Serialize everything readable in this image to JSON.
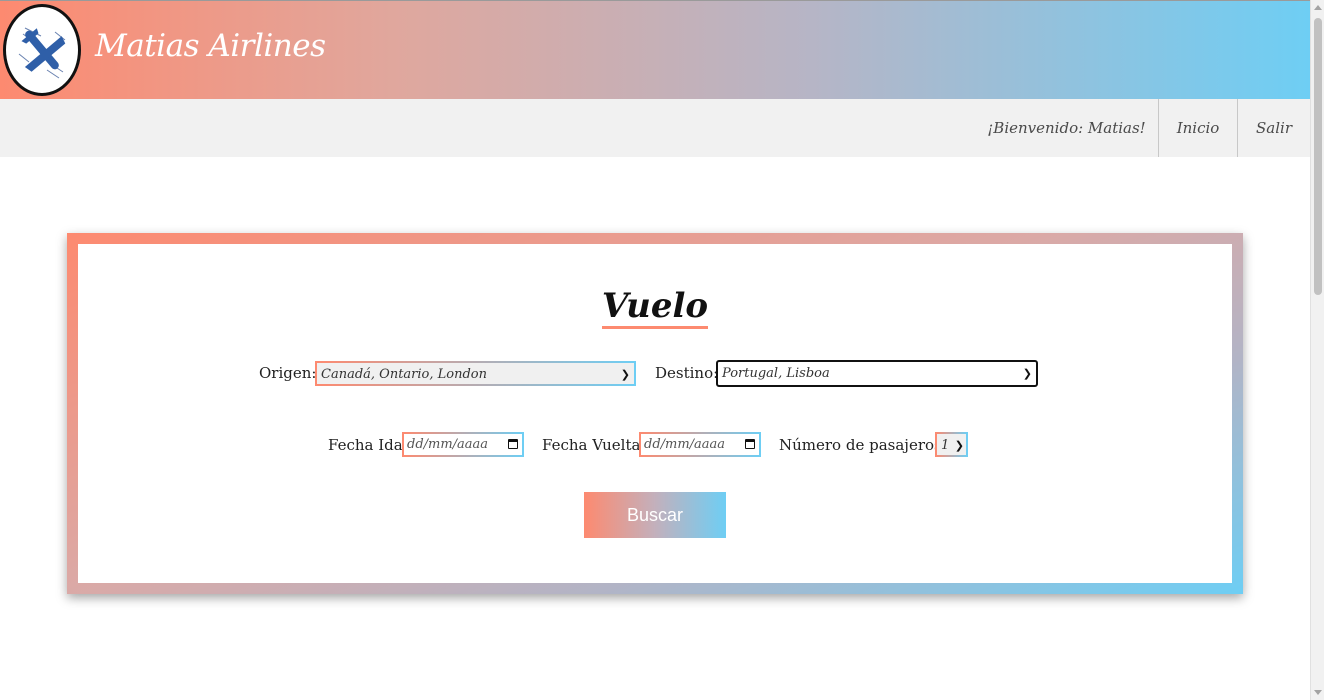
{
  "header": {
    "brand": "Matias Airlines",
    "logo_icon": "airplane-icon"
  },
  "nav": {
    "welcome": "¡Bienvenido: Matias!",
    "home": "Inicio",
    "logout": "Salir"
  },
  "form": {
    "title": "Vuelo",
    "origin_label": "Origen:",
    "origin_value": "Canadá, Ontario, London",
    "destination_label": "Destino:",
    "destination_value": "Portugal, Lisboa",
    "depart_label": "Fecha Ida:",
    "depart_placeholder": "dd/mm/aaaa",
    "return_label": "Fecha Vuelta:",
    "return_placeholder": "dd/mm/aaaa",
    "passengers_label": "Número de pasajeros:",
    "passengers_value": "1",
    "search_button": "Buscar"
  },
  "colors": {
    "gradient_start": "#fd8a70",
    "gradient_end": "#6ecef4"
  }
}
